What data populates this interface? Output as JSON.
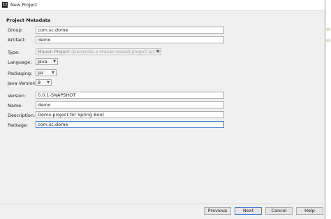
{
  "window": {
    "icon": "IJ",
    "title": "New Project"
  },
  "section_title": "Project Metadata",
  "fields": {
    "group": {
      "label": "Group:",
      "value": "com.sc.dome"
    },
    "artifact": {
      "label": "Artifact:",
      "value": "demo"
    },
    "type": {
      "label": "Type:",
      "value": "Maven Project",
      "hint": "(Generate a Maven based project archive.)"
    },
    "language": {
      "label": "Language:",
      "value": "Java"
    },
    "packaging": {
      "label": "Packaging:",
      "value": "Jar"
    },
    "java_version": {
      "label": "Java Version:",
      "value": "8"
    },
    "version": {
      "label": "Version:",
      "value": "0.0.1-SNAPSHOT"
    },
    "name": {
      "label": "Name:",
      "value": "demo"
    },
    "description": {
      "label": "Description:",
      "value": "Demo project for Spring Boot"
    },
    "package": {
      "label": "Package:",
      "value": "com.sc.dome"
    }
  },
  "buttons": {
    "previous": "Previous",
    "next": "Next",
    "cancel": "Cancel",
    "help": "Help"
  },
  "icons": {
    "app": "intellij-icon",
    "dropdown": "chevron-down-icon"
  }
}
